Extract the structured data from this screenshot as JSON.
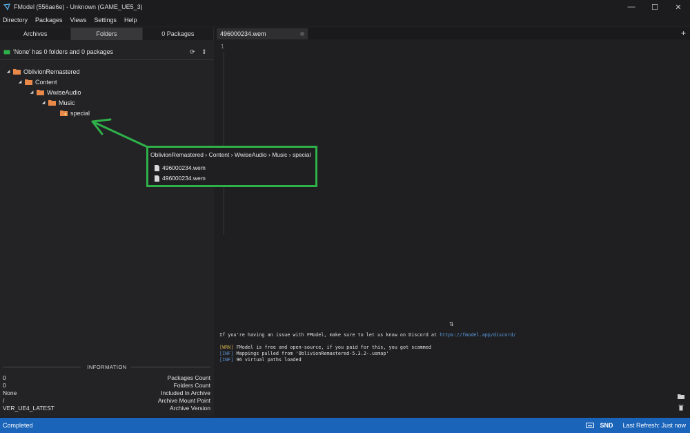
{
  "window": {
    "title": "FModel (556ae6e) - Unknown (GAME_UE5_3)",
    "controls": [
      "—",
      "☐",
      "✕"
    ]
  },
  "menu": [
    "Directory",
    "Packages",
    "Views",
    "Settings",
    "Help"
  ],
  "left_tabs": [
    {
      "label": "Archives",
      "active": false
    },
    {
      "label": "Folders",
      "active": true
    },
    {
      "label": "0 Packages",
      "active": false
    }
  ],
  "folder_info": {
    "text": "'None' has 0 folders and 0 packages",
    "refresh_icon": "refresh-icon",
    "collapse_icon": "collapse-icon"
  },
  "tree": [
    {
      "label": "OblivionRemastered",
      "depth": 0,
      "expanded": true
    },
    {
      "label": "Content",
      "depth": 1,
      "expanded": true
    },
    {
      "label": "WwiseAudio",
      "depth": 2,
      "expanded": true
    },
    {
      "label": "Music",
      "depth": 3,
      "expanded": true
    },
    {
      "label": "special",
      "depth": 4,
      "expanded": false
    }
  ],
  "information": {
    "title": "INFORMATION",
    "rows": [
      {
        "value": "0",
        "label": "Packages Count"
      },
      {
        "value": "0",
        "label": "Folders Count"
      },
      {
        "value": "None",
        "label": "Included In Archive"
      },
      {
        "value": "/",
        "label": "Archive Mount Point"
      },
      {
        "value": "VER_UE4_LATEST",
        "label": "Archive Version"
      }
    ]
  },
  "document_tab": {
    "title": "496000234.wem",
    "add_label": "+"
  },
  "editor": {
    "line_number": "1"
  },
  "console": {
    "splitter_glyph": "⇅",
    "line1_prefix": "If you're having an issue with FModel, make sure to let us know on Discord at ",
    "line1_link": "https://fmodel.app/discord/",
    "line2_tag": "[WRN]",
    "line2_text": " FModel is free and open-source, if you paid for this, you got scammed",
    "line3_tag": "[INF]",
    "line3_text": " Mappings pulled from 'OblivionRemastered-5.3.2-.usmap'",
    "line4_tag": "[INF]",
    "line4_text": " 96 virtual paths loaded"
  },
  "status": {
    "text": "Completed",
    "snd": "SND",
    "last_refresh": "Last Refresh: Just now"
  },
  "callout": {
    "breadcrumb": "OblivionRemastered  ›  Content  ›  WwiseAudio  ›  Music  ›  special",
    "files": [
      "496000234.wem",
      "496000234.wem"
    ],
    "border_color": "#2fb14a"
  },
  "colors": {
    "accent_status": "#1a64b9",
    "folder": "#e8894a",
    "annotation_green": "#2fb14a"
  }
}
